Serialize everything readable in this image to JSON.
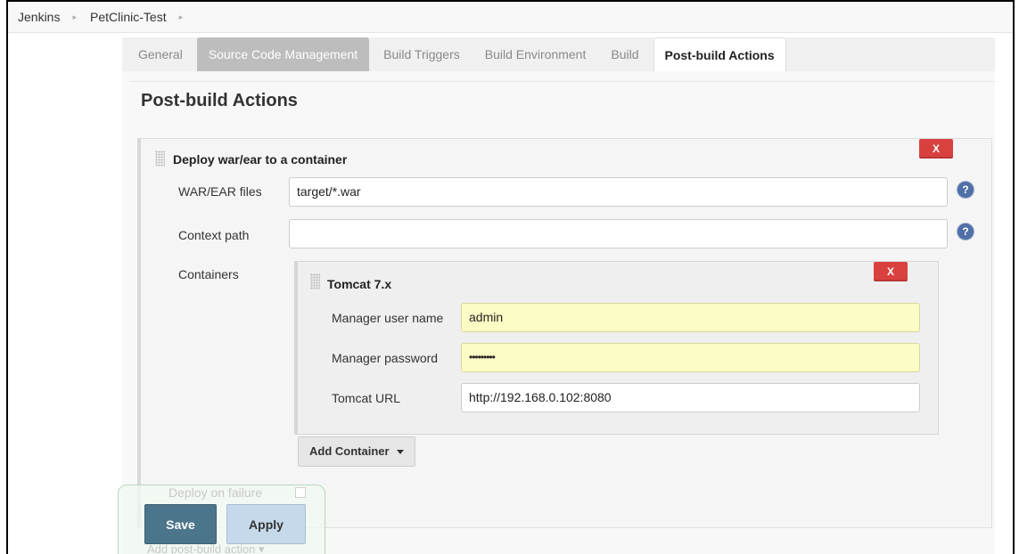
{
  "breadcrumb": {
    "items": [
      "Jenkins",
      "PetClinic-Test"
    ],
    "separator": "▸"
  },
  "tabs": [
    {
      "label": "General"
    },
    {
      "label": "Source Code Management"
    },
    {
      "label": "Build Triggers"
    },
    {
      "label": "Build Environment"
    },
    {
      "label": "Build"
    },
    {
      "label": "Post-build Actions"
    }
  ],
  "active_tab": "Post-build Actions",
  "section": {
    "title": "Post-build Actions"
  },
  "deploy": {
    "title": "Deploy war/ear to a container",
    "delete_label": "X",
    "war_label": "WAR/EAR files",
    "war_value": "target/*.war",
    "context_label": "Context path",
    "context_value": "",
    "containers_label": "Containers",
    "help_glyph": "?"
  },
  "tomcat": {
    "title": "Tomcat 7.x",
    "delete_label": "X",
    "user_label": "Manager user name",
    "user_value": "admin",
    "password_label": "Manager password",
    "password_value": "•••••••••",
    "url_label": "Tomcat URL",
    "url_value": "http://192.168.0.102:8080"
  },
  "add_container_label": "Add Container",
  "deploy_on_failure_label": "Deploy on failure",
  "add_post_build_label": "Add post-build action",
  "buttons": {
    "save": "Save",
    "apply": "Apply"
  },
  "colors": {
    "delete": "#d9413f",
    "save": "#4b758b",
    "apply": "#c6d9ea",
    "autofill": "#fbfbc4"
  }
}
